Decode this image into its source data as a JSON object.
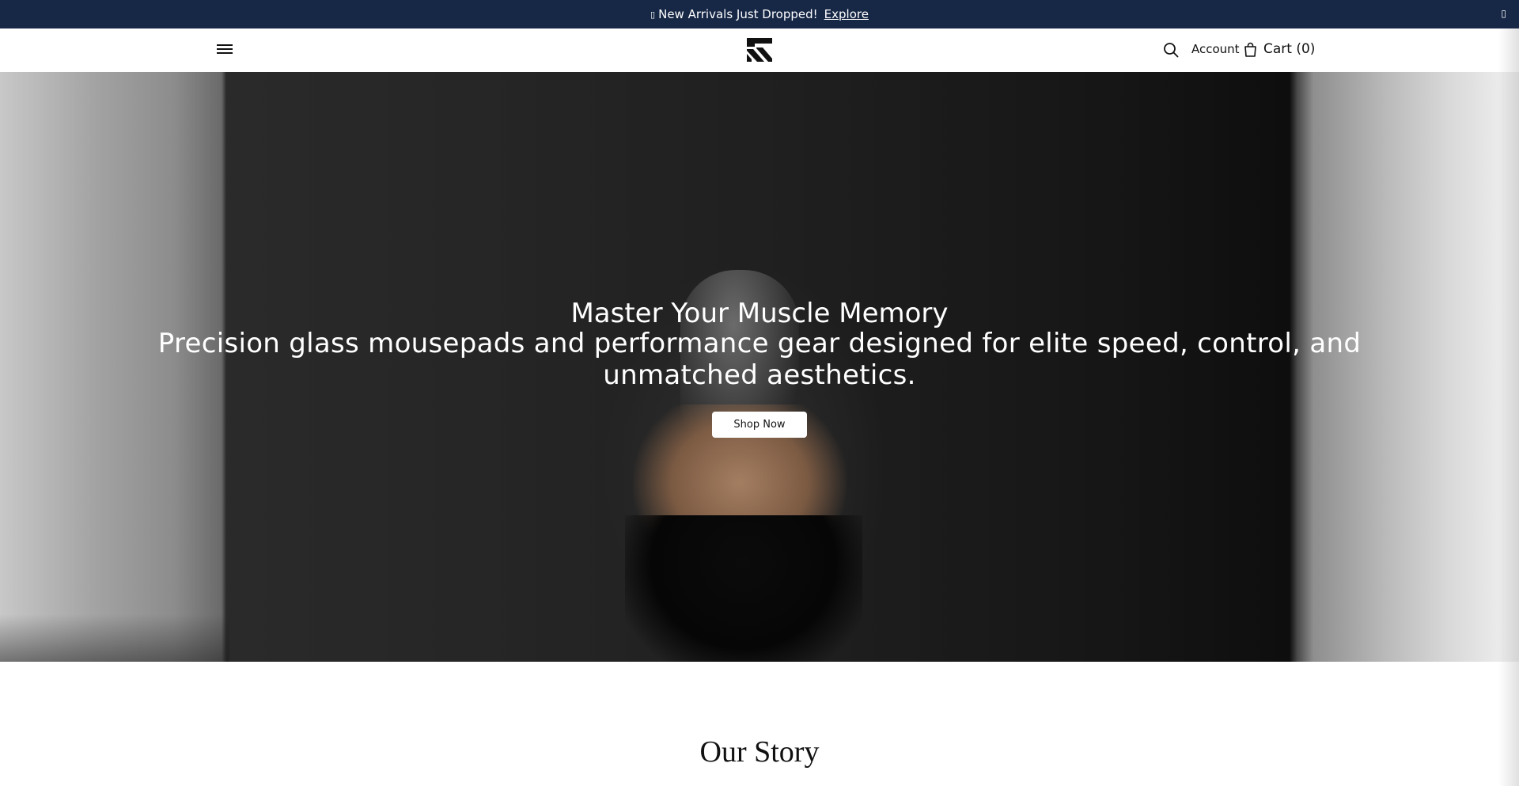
{
  "announcement": {
    "icon": "sparkle-icon",
    "glyph": "▯",
    "text": "New Arrivals Just Dropped!",
    "link_label": "Explore",
    "close_glyph": "▯",
    "background": "#172746"
  },
  "header": {
    "menu_icon": "hamburger-menu-icon",
    "logo_icon": "brand-logo-icon",
    "search_icon": "search-icon",
    "account_label": "Account",
    "cart_icon": "shopping-bag-icon",
    "cart_label": "Cart (0)"
  },
  "hero": {
    "title": "Master Your Muscle Memory",
    "subtitle": "Precision glass mousepads and performance gear designed for elite speed, control, and unmatched aesthetics.",
    "button_label": "Shop Now"
  },
  "story": {
    "title": "Our Story"
  }
}
